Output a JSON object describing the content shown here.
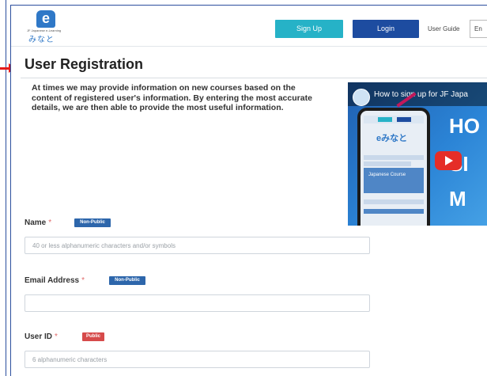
{
  "header": {
    "logo_text": "みなと",
    "logo_small_text": "JF Japanese e-Learning",
    "signup_label": "Sign Up",
    "login_label": "Login",
    "user_guide_label": "User Guide",
    "language_value": "En"
  },
  "page": {
    "title": "User Registration",
    "intro": "At times we may provide information on new courses based on the content of registered user's information. By entering the most accurate details, we are then able to provide the most useful information."
  },
  "video": {
    "title": "How to sign up for JF Japa",
    "overlay_lines": [
      "HO",
      "SI",
      "M"
    ],
    "phone_logo": "eみなと",
    "phone_panel_text": "Japanese Course"
  },
  "form": {
    "required_mark": "*",
    "fields": [
      {
        "label": "Name",
        "badge": "Non-Public",
        "placeholder": "40 or less alphanumeric characters and/or symbols"
      },
      {
        "label": "Email Address",
        "badge": "Non-Public",
        "placeholder": ""
      },
      {
        "label": "User ID",
        "badge": "Public",
        "placeholder": "6 alphanumeric characters"
      }
    ]
  },
  "colors": {
    "accent_blue": "#1d4ca0",
    "signup_teal": "#26b2c7",
    "badge_non_public": "#2d66ab",
    "badge_public": "#d64a4a",
    "required": "#e06a6a",
    "annotation_arrow": "#e31a1a"
  }
}
